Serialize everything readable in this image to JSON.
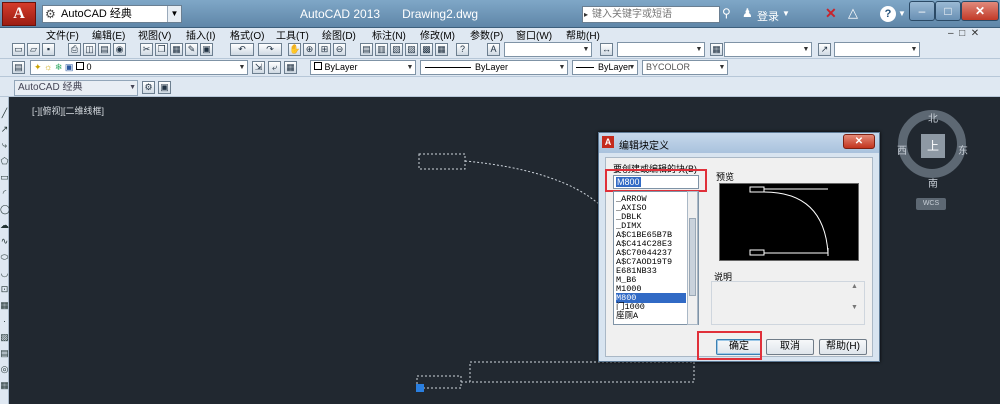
{
  "title_bar": {
    "workspace": "AutoCAD 经典",
    "app_title": "AutoCAD 2013",
    "file_name": "Drawing2.dwg",
    "search_placeholder": "键入关键字或短语",
    "login_label": "登录"
  },
  "menu": [
    {
      "label": "文件(F)"
    },
    {
      "label": "编辑(E)"
    },
    {
      "label": "视图(V)"
    },
    {
      "label": "插入(I)"
    },
    {
      "label": "格式(O)"
    },
    {
      "label": "工具(T)"
    },
    {
      "label": "绘图(D)"
    },
    {
      "label": "标注(N)"
    },
    {
      "label": "修改(M)"
    },
    {
      "label": "参数(P)"
    },
    {
      "label": "窗口(W)"
    },
    {
      "label": "帮助(H)"
    }
  ],
  "properties": {
    "layer": "0",
    "color": "ByLayer",
    "linetype": "ByLayer",
    "lineweight": "ByLayer",
    "plotstyle": "BYCOLOR"
  },
  "workspace_combo": "AutoCAD 经典",
  "viewport_label": "[-][俯视][二维线框]",
  "compass": {
    "north": "北",
    "south": "南",
    "east": "东",
    "west": "西",
    "up": "上",
    "wcs": "WCS"
  },
  "dialog": {
    "title": "编辑块定义",
    "block_label": "要创建或编辑的块(B)",
    "block_name": "M800",
    "blocks": [
      "_ARROW",
      "_AXISO",
      "_DBLK",
      "_DIMX",
      "A$C1BE65B7B",
      "A$C414C28E3",
      "A$C70044237",
      "A$C7AOD19T9",
      "E681NB33",
      "M_B6",
      "M1000",
      "M800",
      "门1000",
      "座厕A"
    ],
    "selected_index": 11,
    "preview_label": "预览",
    "desc_label": "说明",
    "ok": "确定",
    "cancel": "取消",
    "help": "帮助(H)"
  },
  "colors": {
    "canvas": "#212830",
    "highlight": "#e0303a",
    "selection": "#316ac5"
  }
}
